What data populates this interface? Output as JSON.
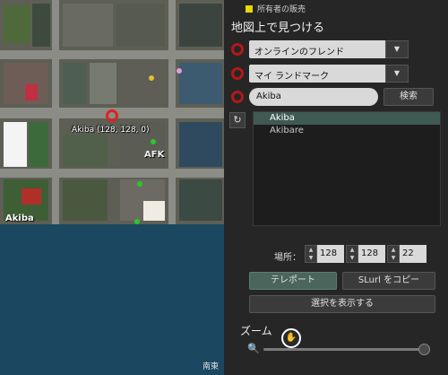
{
  "map": {
    "region_name": "Akiba",
    "location_label": "Akiba (128, 128, 0)",
    "afk_label": "AFK",
    "compass_label": "南東"
  },
  "panel": {
    "legend_label": "所有者の販売",
    "title": "地図上で見つける",
    "friends_combo": "オンラインのフレンド",
    "landmark_combo": "マイ ランドマーク",
    "search_value": "Akiba",
    "search_button": "検索",
    "results": [
      "Akiba",
      "Akibare"
    ],
    "coords_label": "場所：",
    "coord_x": "128",
    "coord_y": "128",
    "coord_z": "22",
    "teleport_button": "テレポート",
    "slurl_button": "SLurl をコピー",
    "show_selection_button": "選択を表示する",
    "zoom_label": "ズーム"
  },
  "colors": {
    "legend": "#e6d800",
    "ring": "#b41818",
    "selected_row": "#3f5a52",
    "teleport_button": "#49655c",
    "water": "#1b4860"
  }
}
